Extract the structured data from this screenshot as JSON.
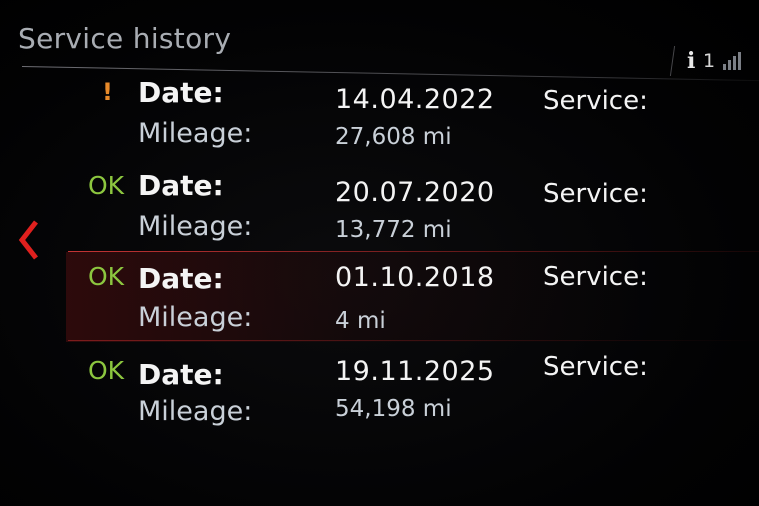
{
  "header": {
    "title": "Service history",
    "info_icon": "info-icon",
    "info_glyph": "i",
    "notification_count": "1",
    "signal_icon": "signal-strength-icon"
  },
  "navigation": {
    "back_icon": "chevron-left-icon",
    "accent_color": "#e0201e"
  },
  "entries": [
    {
      "status": "!",
      "status_type": "warning",
      "date_label": "Date:",
      "date": "14.04.2022",
      "mileage_label": "Mileage:",
      "mileage": "27,608 mi",
      "service_label": "Service:"
    },
    {
      "status": "OK",
      "status_type": "ok",
      "date_label": "Date:",
      "date": "20.07.2020",
      "mileage_label": "Mileage:",
      "mileage": "13,772 mi",
      "service_label": "Service:"
    },
    {
      "status": "OK",
      "status_type": "ok",
      "date_label": "Date:",
      "date": "01.10.2018",
      "mileage_label": "Mileage:",
      "mileage": "4 mi",
      "service_label": "Service:"
    },
    {
      "status": "OK",
      "status_type": "ok",
      "date_label": "Date:",
      "date": "19.11.2025",
      "mileage_label": "Mileage:",
      "mileage": "54,198 mi",
      "service_label": "Service:"
    }
  ],
  "colors": {
    "warning": "#e88a2a",
    "ok": "#8cc63f",
    "selection": "#e03c3c"
  }
}
